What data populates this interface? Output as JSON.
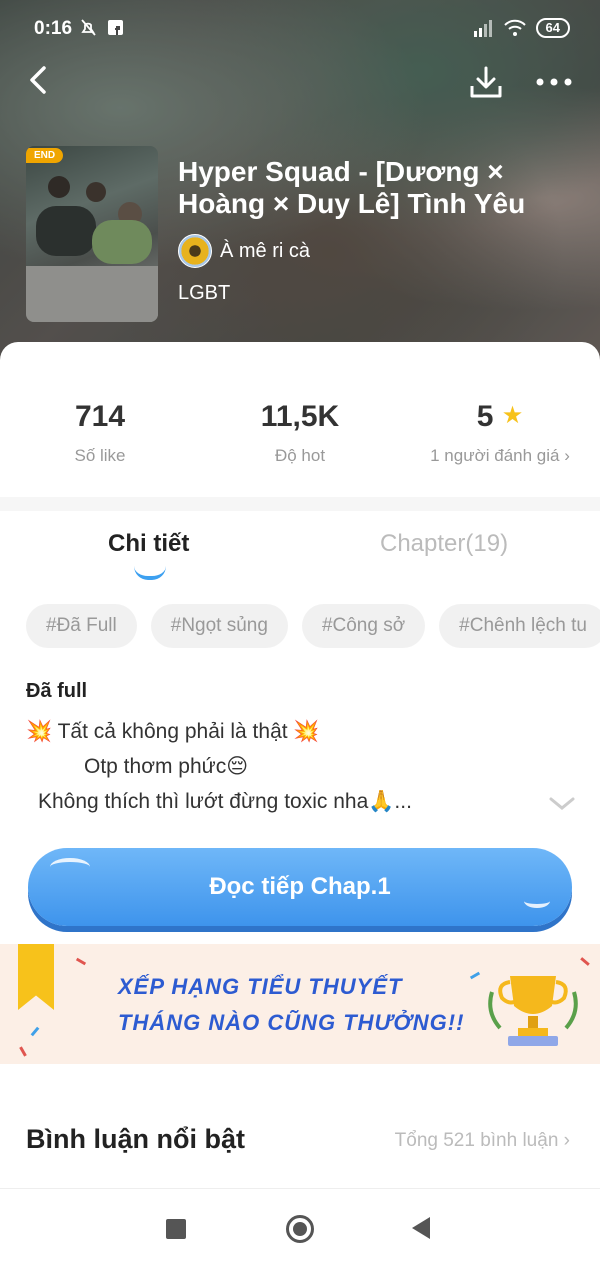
{
  "status_bar": {
    "time": "0:16",
    "battery": "64"
  },
  "book": {
    "end_badge": "END",
    "title": "Hyper Squad - [Dương × Hoàng × Duy Lê] Tình Yêu",
    "author": "À mê ri cà",
    "category": "LGBT"
  },
  "stats": {
    "likes": {
      "value": "714",
      "label": "Số like"
    },
    "hot": {
      "value": "11,5K",
      "label": "Độ hot"
    },
    "rating": {
      "value": "5",
      "label": "1 người đánh giá ›"
    }
  },
  "tabs": {
    "detail": "Chi tiết",
    "chapters": "Chapter(19)"
  },
  "tags": [
    "#Đã Full",
    "#Ngọt sủng",
    "#Công sở",
    "#Chênh lệch tu"
  ],
  "description": {
    "title": "Đã full",
    "line1": "💥 Tất cả không phải là thật 💥",
    "line2": "Otp thơm phức😔",
    "line3": "Không thích thì lướt đừng toxic nha🙏..."
  },
  "read_button": "Đọc tiếp Chap.1",
  "banner": {
    "line1": "XẾP HẠNG TIỂU THUYẾT",
    "line2": "THÁNG NÀO CŨNG THƯỞNG!!"
  },
  "comments": {
    "title": "Bình luận nổi bật",
    "total": "Tổng 521 bình luận ›"
  },
  "colors": {
    "accent": "#3da0f0",
    "star": "#f7c21b",
    "banner_text": "#2d5bd1"
  }
}
